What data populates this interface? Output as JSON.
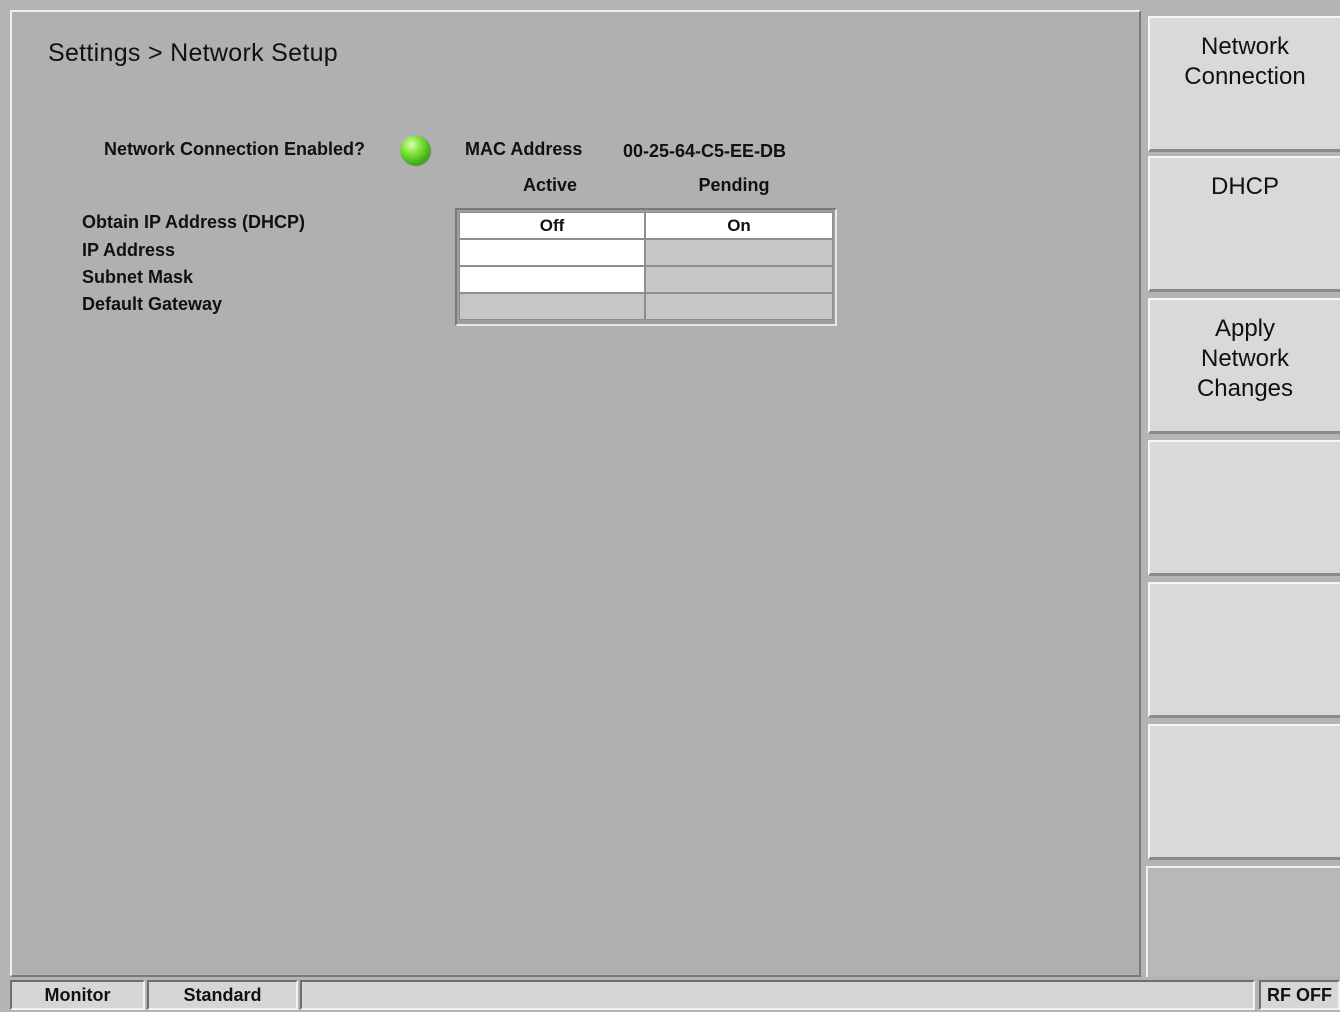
{
  "breadcrumb": "Settings > Network Setup",
  "network": {
    "enabled_label": "Network Connection Enabled?",
    "enabled_status": "on",
    "led_color": "#3db016",
    "mac_label": "MAC Address",
    "mac_value": "00-25-64-C5-EE-DB"
  },
  "table": {
    "headers": {
      "active": "Active",
      "pending": "Pending"
    },
    "rows": [
      {
        "label": "Obtain IP Address (DHCP)",
        "active": "Off",
        "pending": "On"
      },
      {
        "label": "IP Address",
        "active": "",
        "pending": ""
      },
      {
        "label": "Subnet Mask",
        "active": "",
        "pending": ""
      },
      {
        "label": "Default Gateway",
        "active": "",
        "pending": ""
      }
    ]
  },
  "softkeys": [
    {
      "lines": [
        "Network",
        "Connection"
      ]
    },
    {
      "lines": [
        "DHCP"
      ]
    },
    {
      "lines": [
        "Apply",
        "Network",
        "Changes"
      ]
    },
    {
      "lines": []
    },
    {
      "lines": []
    },
    {
      "lines": []
    }
  ],
  "status_bar": {
    "mode": "Monitor",
    "standard": "Standard",
    "message": "",
    "rf_status": "RF OFF"
  }
}
